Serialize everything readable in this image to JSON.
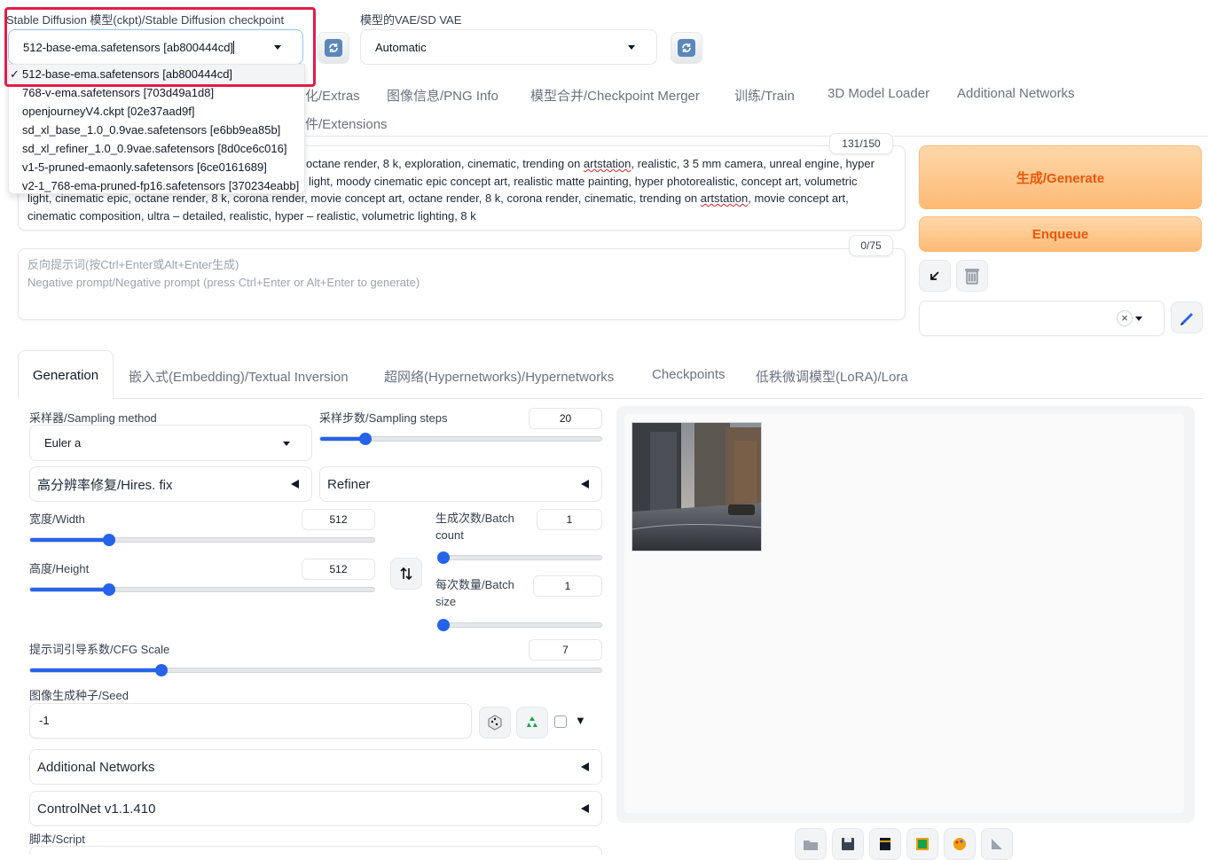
{
  "checkpoint": {
    "label": "Stable Diffusion 模型(ckpt)/Stable Diffusion checkpoint",
    "value": "512-base-ema.safetensors [ab800444cd]",
    "options": [
      "512-base-ema.safetensors [ab800444cd]",
      "768-v-ema.safetensors [703d49a1d8]",
      "openjourneyV4.ckpt [02e37aad9f]",
      "sd_xl_base_1.0_0.9vae.safetensors [e6bb9ea85b]",
      "sd_xl_refiner_1.0_0.9vae.safetensors [8d0ce6c016]",
      "v1-5-pruned-emaonly.safetensors [6ce0161689]",
      "v2-1_768-ema-pruned-fp16.safetensors [370234eabb]"
    ],
    "selected_mark": "✓"
  },
  "vae": {
    "label": "模型的VAE/SD VAE",
    "value": "Automatic"
  },
  "main_tabs": {
    "row1": [
      "化/Extras",
      "图像信息/PNG Info",
      "模型合并/Checkpoint Merger",
      "训练/Train",
      "3D Model Loader",
      "Additional Networks"
    ],
    "row2": [
      "件/Extensions"
    ]
  },
  "prompt": {
    "counter": "131/150",
    "line1": "octane render, 8 k, exploration, cinematic, trending on",
    "line1_spell": "artstation",
    "line1_rest": ", realistic, 3 5 mm camera, unreal engine, hyper",
    "line2": "light, moody cinematic epic concept art, realistic matte painting, hyper photorealistic, concept art, volumetric",
    "line3a": "light, cinematic epic, octane render, 8 k, corona render, movie concept art, octane render, 8 k, corona render, cinematic, trending on",
    "line3_spell": "artstation",
    "line3b": ", movie concept art,",
    "line4": "cinematic composition, ultra – detailed, realistic, hyper – realistic, volumetric lighting, 8 k"
  },
  "negative_prompt": {
    "counter": "0/75",
    "placeholder_line1": "反向提示词(按Ctrl+Enter或Alt+Enter生成)",
    "placeholder_line2": "Negative prompt/Negative prompt (press Ctrl+Enter or Alt+Enter to generate)"
  },
  "actions": {
    "generate": "生成/Generate",
    "enqueue": "Enqueue",
    "clear_mark": "×"
  },
  "sub_tabs": [
    "Generation",
    "嵌入式(Embedding)/Textual Inversion",
    "超网络(Hypernetworks)/Hypernetworks",
    "Checkpoints",
    "低秩微调模型(LoRA)/Lora"
  ],
  "generation": {
    "sampling_method_label": "采样器/Sampling method",
    "sampling_method": "Euler a",
    "sampling_steps_label": "采样步数/Sampling steps",
    "sampling_steps": "20",
    "hires_fix": "高分辨率修复/Hires. fix",
    "refiner": "Refiner",
    "width_label": "宽度/Width",
    "width": "512",
    "height_label": "高度/Height",
    "height": "512",
    "batch_count_label_1": "生成次数/Batch",
    "batch_count_label_2": "count",
    "batch_count": "1",
    "batch_size_label_1": "每次数量/Batch",
    "batch_size_label_2": "size",
    "batch_size": "1",
    "cfg_label": "提示词引导系数/CFG Scale",
    "cfg": "7",
    "seed_label": "图像生成种子/Seed",
    "seed": "-1",
    "seed_extra": "▼",
    "additional_networks": "Additional Networks",
    "controlnet": "ControlNet v1.1.410",
    "script_label": "脚本/Script"
  },
  "slider_levels": {
    "sampling_steps": 0.16,
    "width": 0.23,
    "height": 0.23,
    "batch_count": 0.0,
    "batch_size": 0.0,
    "cfg": 0.23
  },
  "colors": {
    "accent": "#2563eb",
    "generate_text": "#ea580c",
    "generate_bg": "#fdba74",
    "highlight_border": "#e11d48"
  },
  "icons": [
    "refresh-icon",
    "arrow-down-left-icon",
    "trash-icon",
    "pencil-icon",
    "swap-icon",
    "dice-icon",
    "recycle-icon",
    "folder-icon",
    "save-icon",
    "zip-icon",
    "image-icon",
    "palette-icon",
    "triangle-icon"
  ]
}
